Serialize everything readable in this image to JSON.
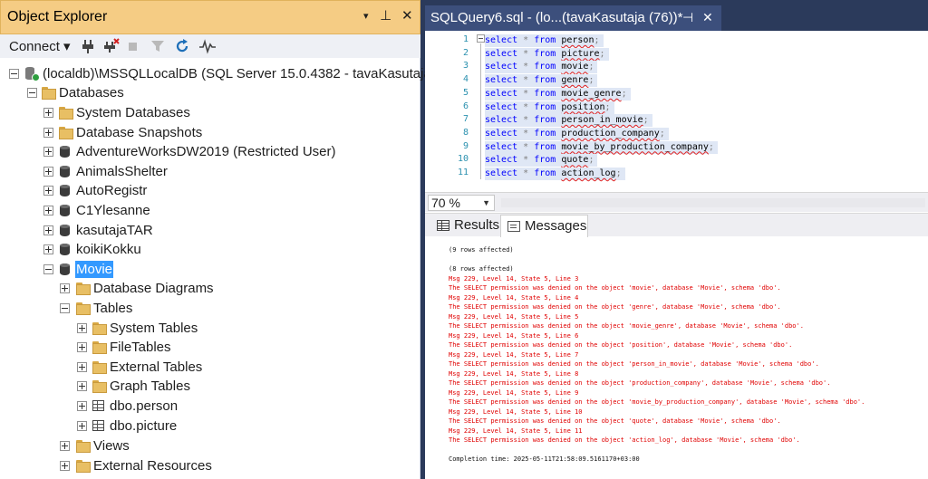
{
  "object_explorer": {
    "title": "Object Explorer",
    "controls": {
      "dropdown": "▾",
      "pin": "⊥",
      "close": "✕"
    },
    "toolbar": {
      "connect_label": "Connect ▾"
    },
    "tree": [
      {
        "label": "(localdb)\\MSSQLLocalDB (SQL Server 15.0.4382 - tavaKasutaja)",
        "icon": "server-icon",
        "expander": "minus"
      },
      {
        "label": "Databases",
        "icon": "folder-icon",
        "expander": "minus"
      },
      {
        "label": "System Databases",
        "icon": "folder-icon",
        "expander": "plus"
      },
      {
        "label": "Database Snapshots",
        "icon": "folder-icon",
        "expander": "plus"
      },
      {
        "label": "AdventureWorksDW2019 (Restricted User)",
        "icon": "database-icon",
        "expander": "plus"
      },
      {
        "label": "AnimalsShelter",
        "icon": "database-icon",
        "expander": "plus"
      },
      {
        "label": "AutoRegistr",
        "icon": "database-icon",
        "expander": "plus"
      },
      {
        "label": "C1Ylesanne",
        "icon": "database-icon",
        "expander": "plus"
      },
      {
        "label": "kasutajaTAR",
        "icon": "database-icon",
        "expander": "plus"
      },
      {
        "label": "koikiKokku",
        "icon": "database-icon",
        "expander": "plus"
      },
      {
        "label": "Movie",
        "icon": "database-icon",
        "expander": "minus",
        "selected": true
      },
      {
        "label": "Database Diagrams",
        "icon": "folder-icon",
        "expander": "plus"
      },
      {
        "label": "Tables",
        "icon": "folder-icon",
        "expander": "minus"
      },
      {
        "label": "System Tables",
        "icon": "folder-icon",
        "expander": "plus"
      },
      {
        "label": "FileTables",
        "icon": "folder-icon",
        "expander": "plus"
      },
      {
        "label": "External Tables",
        "icon": "folder-icon",
        "expander": "plus"
      },
      {
        "label": "Graph Tables",
        "icon": "folder-icon",
        "expander": "plus"
      },
      {
        "label": "dbo.person",
        "icon": "table-icon",
        "expander": "plus"
      },
      {
        "label": "dbo.picture",
        "icon": "table-icon",
        "expander": "plus"
      },
      {
        "label": "Views",
        "icon": "folder-icon",
        "expander": "plus"
      },
      {
        "label": "External Resources",
        "icon": "folder-icon",
        "expander": "plus"
      }
    ]
  },
  "query_window": {
    "tab_title": "SQLQuery6.sql - (lo...(tavaKasutaja (76))*",
    "tab_pin": "⊣",
    "tab_close": "✕",
    "code": {
      "keyword_select": "select",
      "star": "*",
      "keyword_from": "from",
      "lines": [
        {
          "num": "1",
          "table": "person"
        },
        {
          "num": "2",
          "table": "picture"
        },
        {
          "num": "3",
          "table": "movie"
        },
        {
          "num": "4",
          "table": "genre"
        },
        {
          "num": "5",
          "table": "movie_genre"
        },
        {
          "num": "6",
          "table": "position"
        },
        {
          "num": "7",
          "table": "person_in_movie"
        },
        {
          "num": "8",
          "table": "production_company"
        },
        {
          "num": "9",
          "table": "movie_by_production_company"
        },
        {
          "num": "10",
          "table": "quote"
        },
        {
          "num": "11",
          "table": "action_log"
        }
      ]
    },
    "zoom": "70 %",
    "result_tabs": {
      "results": "Results",
      "messages": "Messages"
    },
    "messages": [
      {
        "text": "(9 rows affected)",
        "type": "ok"
      },
      {
        "text": "",
        "type": "ok"
      },
      {
        "text": "(8 rows affected)",
        "type": "ok"
      },
      {
        "text": "Msg 229, Level 14, State 5, Line 3",
        "type": "err"
      },
      {
        "text": "The SELECT permission was denied on the object 'movie', database 'Movie', schema 'dbo'.",
        "type": "err"
      },
      {
        "text": "Msg 229, Level 14, State 5, Line 4",
        "type": "err"
      },
      {
        "text": "The SELECT permission was denied on the object 'genre', database 'Movie', schema 'dbo'.",
        "type": "err"
      },
      {
        "text": "Msg 229, Level 14, State 5, Line 5",
        "type": "err"
      },
      {
        "text": "The SELECT permission was denied on the object 'movie_genre', database 'Movie', schema 'dbo'.",
        "type": "err"
      },
      {
        "text": "Msg 229, Level 14, State 5, Line 6",
        "type": "err"
      },
      {
        "text": "The SELECT permission was denied on the object 'position', database 'Movie', schema 'dbo'.",
        "type": "err"
      },
      {
        "text": "Msg 229, Level 14, State 5, Line 7",
        "type": "err"
      },
      {
        "text": "The SELECT permission was denied on the object 'person_in_movie', database 'Movie', schema 'dbo'.",
        "type": "err"
      },
      {
        "text": "Msg 229, Level 14, State 5, Line 8",
        "type": "err"
      },
      {
        "text": "The SELECT permission was denied on the object 'production_company', database 'Movie', schema 'dbo'.",
        "type": "err"
      },
      {
        "text": "Msg 229, Level 14, State 5, Line 9",
        "type": "err"
      },
      {
        "text": "The SELECT permission was denied on the object 'movie_by_production_company', database 'Movie', schema 'dbo'.",
        "type": "err"
      },
      {
        "text": "Msg 229, Level 14, State 5, Line 10",
        "type": "err"
      },
      {
        "text": "The SELECT permission was denied on the object 'quote', database 'Movie', schema 'dbo'.",
        "type": "err"
      },
      {
        "text": "Msg 229, Level 14, State 5, Line 11",
        "type": "err"
      },
      {
        "text": "The SELECT permission was denied on the object 'action_log', database 'Movie', schema 'dbo'.",
        "type": "err"
      },
      {
        "text": "",
        "type": "ok"
      },
      {
        "text": "Completion time: 2025-05-11T21:58:09.5161170+03:00",
        "type": "ok"
      }
    ]
  },
  "colors": {
    "title_bar": "#f5cc84",
    "selection": "#3399ff",
    "tab_active": "#3c4f7c",
    "error_text": "#e00000",
    "keyword": "#0000ff"
  }
}
